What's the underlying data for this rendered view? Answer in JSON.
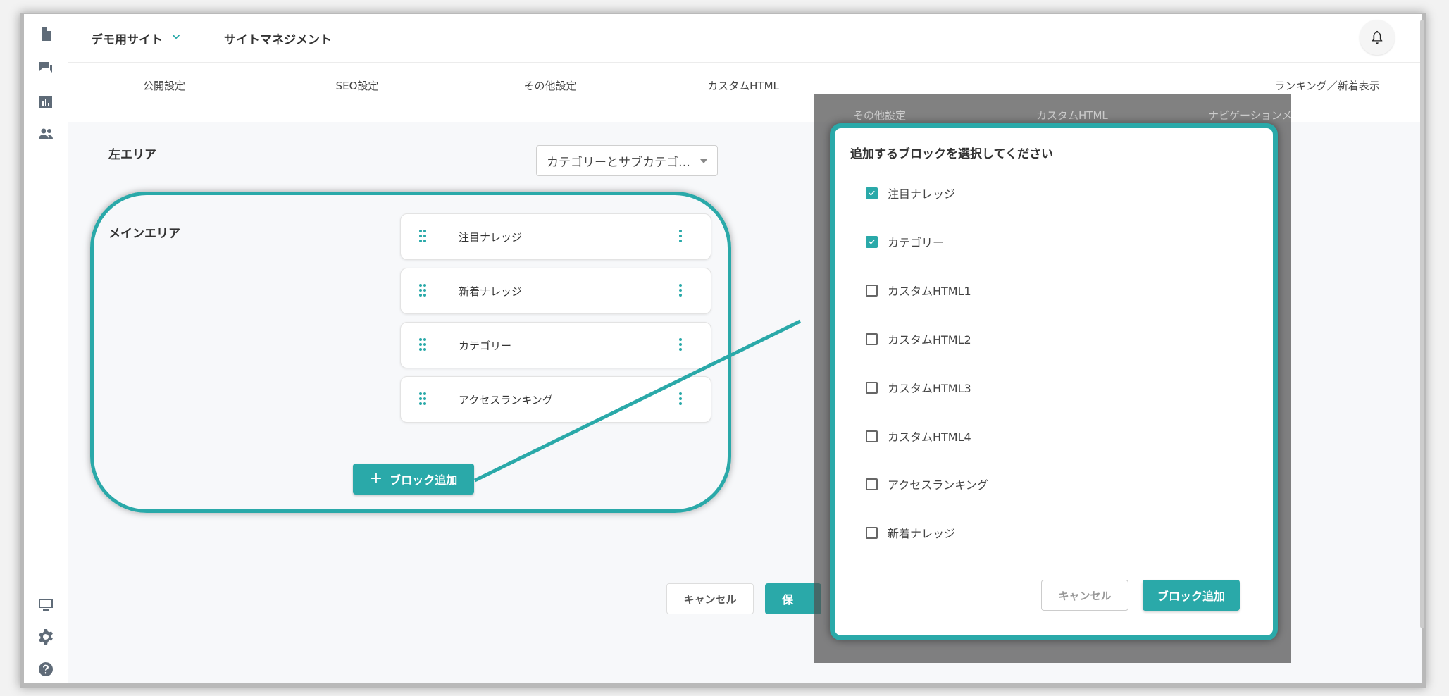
{
  "header": {
    "site_name": "デモ用サイト",
    "title": "サイトマネジメント",
    "notification_icon": "bell-icon"
  },
  "sidebar": {
    "items": [
      {
        "icon": "document-icon"
      },
      {
        "icon": "chat-icon"
      },
      {
        "icon": "bar-chart-icon"
      },
      {
        "icon": "people-icon"
      },
      {
        "icon": "monitor-icon"
      },
      {
        "icon": "gear-icon"
      },
      {
        "icon": "help-icon"
      }
    ]
  },
  "tabs": [
    "公開設定",
    "SEO設定",
    "その他設定",
    "カスタムHTML",
    "ランキング／新着表示"
  ],
  "overlay_tabs": [
    "その他設定",
    "カスタムHTML",
    "ナビゲーションメ"
  ],
  "left_area": {
    "label": "左エリア",
    "select_value": "カテゴリーとサブカテゴ…"
  },
  "main_area": {
    "label": "メインエリア",
    "blocks": [
      "注目ナレッジ",
      "新着ナレッジ",
      "カテゴリー",
      "アクセスランキング"
    ],
    "add_button": "ブロック追加"
  },
  "footer": {
    "cancel": "キャンセル",
    "save": "保"
  },
  "dialog": {
    "title": "追加するブロックを選択してください",
    "options": [
      {
        "label": "注目ナレッジ",
        "checked": true
      },
      {
        "label": "カテゴリー",
        "checked": true
      },
      {
        "label": "カスタムHTML1",
        "checked": false
      },
      {
        "label": "カスタムHTML2",
        "checked": false
      },
      {
        "label": "カスタムHTML3",
        "checked": false
      },
      {
        "label": "カスタムHTML4",
        "checked": false
      },
      {
        "label": "アクセスランキング",
        "checked": false
      },
      {
        "label": "新着ナレッジ",
        "checked": false
      }
    ],
    "cancel": "キャンセル",
    "add": "ブロック追加"
  },
  "colors": {
    "accent": "#2aa9a9",
    "overlay": "#505050"
  }
}
